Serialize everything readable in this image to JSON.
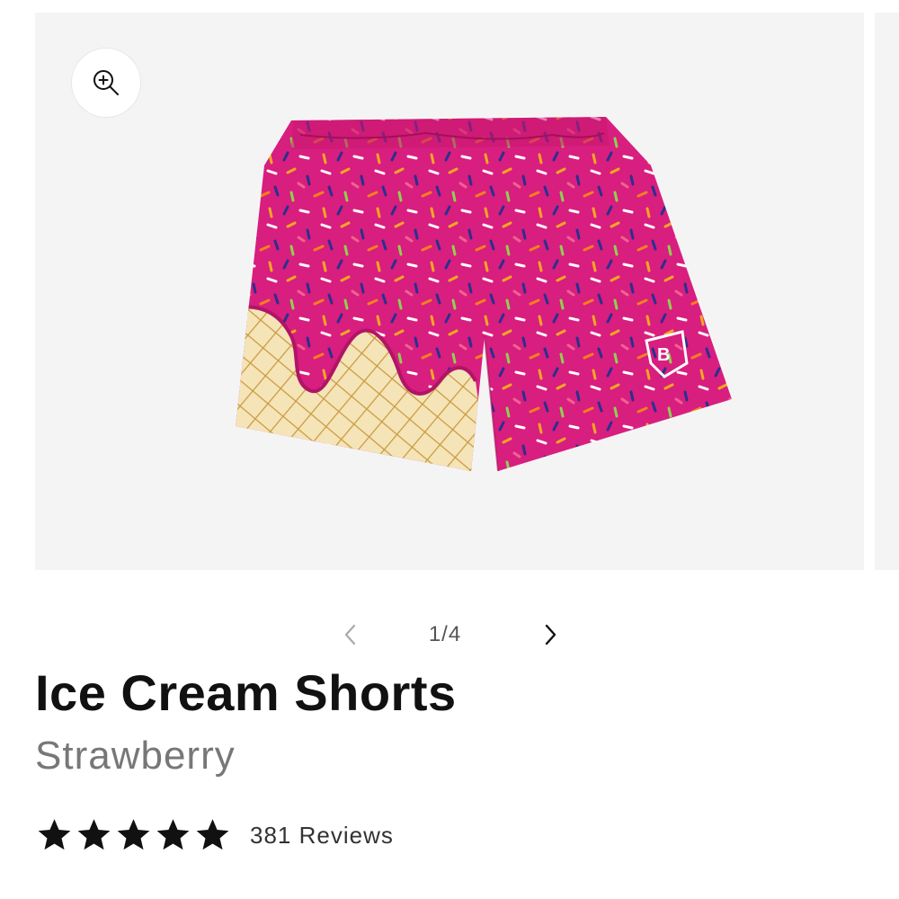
{
  "product": {
    "title": "Ice Cream Shorts",
    "variant": "Strawberry"
  },
  "gallery": {
    "counter": "1/4",
    "current_slide": 1,
    "total_slides": 4,
    "zoom_icon": "zoom-in-icon",
    "prev_icon": "chevron-left-icon",
    "next_icon": "chevron-right-icon",
    "image": {
      "subject": "pink ice cream sprinkle mesh shorts",
      "colors": {
        "pink": "#d81e7e",
        "cone": "#f5e4b8",
        "waffle_line": "#c99a3c"
      }
    }
  },
  "rating": {
    "stars": 5,
    "star_icon": "star-icon",
    "reviews_label": "381 Reviews"
  },
  "colors": {
    "background": "#ffffff",
    "media_background": "#f4f4f4",
    "title": "#111111",
    "variant": "#777777",
    "stars": "#111111"
  }
}
